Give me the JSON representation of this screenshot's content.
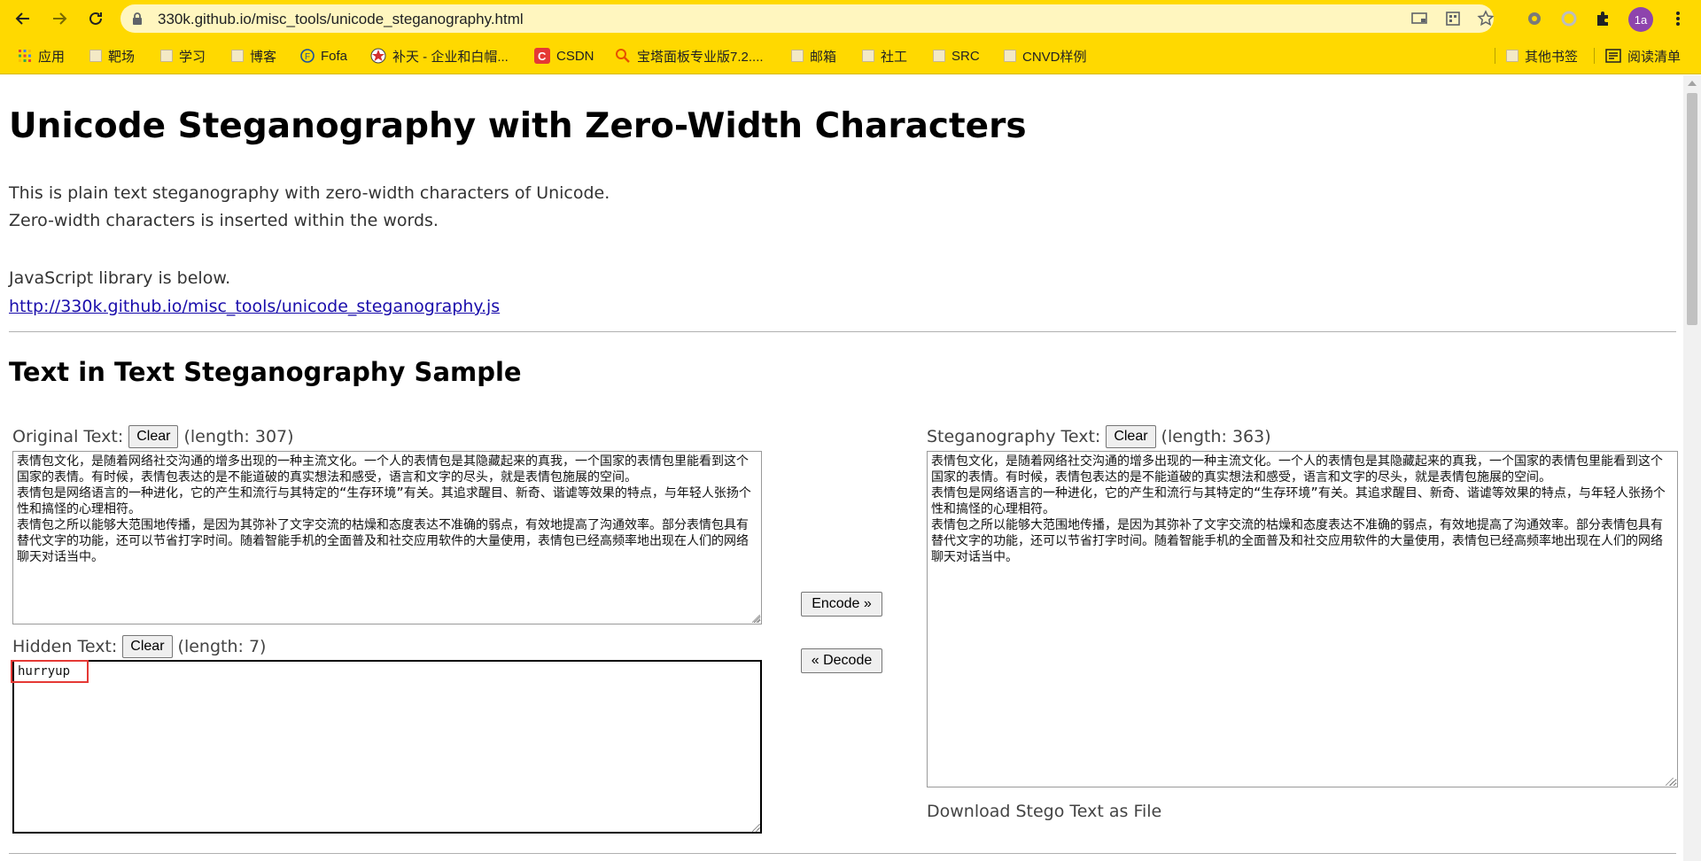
{
  "browser": {
    "url": "330k.github.io/misc_tools/unicode_steganography.html",
    "profile_initials": "1a",
    "bookmarks": [
      {
        "label": "应用",
        "icon": "apps-grid-icon"
      },
      {
        "label": "靶场",
        "icon": "folder-icon"
      },
      {
        "label": "学习",
        "icon": "folder-icon"
      },
      {
        "label": "博客",
        "icon": "folder-icon"
      },
      {
        "label": "Fofa",
        "icon": "fofa-icon"
      },
      {
        "label": "补天 - 企业和白帽...",
        "icon": "butian-icon"
      },
      {
        "label": "CSDN",
        "icon": "csdn-icon"
      },
      {
        "label": "宝塔面板专业版7.2....",
        "icon": "search-icon"
      },
      {
        "label": "邮箱",
        "icon": "folder-icon"
      },
      {
        "label": "社工",
        "icon": "folder-icon"
      },
      {
        "label": "SRC",
        "icon": "folder-icon"
      },
      {
        "label": "CNVD样例",
        "icon": "folder-icon"
      }
    ],
    "other_bookmarks": "其他书签",
    "reading_list": "阅读清单"
  },
  "page": {
    "title": "Unicode Steganography with Zero-Width Characters",
    "intro_line1": "This is plain text steganography with zero-width characters of Unicode.",
    "intro_line2": "Zero-width characters is inserted within the words.",
    "library_text": "JavaScript library is below.",
    "library_link": "http://330k.github.io/misc_tools/unicode_steganography.js",
    "section_title": "Text in Text Steganography Sample",
    "original": {
      "label": "Original Text:",
      "clear": "Clear",
      "length": "(length: 307)",
      "text": "表情包文化，是随着网络社交沟通的增多出现的一种主流文化。一个人的表情包是其隐藏起来的真我，一个国家的表情包里能看到这个国家的表情。有时候，表情包表达的是不能道破的真实想法和感受，语言和文字的尽头，就是表情包施展的空间。\n表情包是网络语言的一种进化，它的产生和流行与其特定的“生存环境”有关。其追求醒目、新奇、谐谑等效果的特点，与年轻人张扬个性和搞怪的心理相符。\n表情包之所以能够大范围地传播，是因为其弥补了文字交流的枯燥和态度表达不准确的弱点，有效地提高了沟通效率。部分表情包具有替代文字的功能，还可以节省打字时间。随着智能手机的全面普及和社交应用软件的大量使用，表情包已经高频率地出现在人们的网络聊天对话当中。"
    },
    "hidden": {
      "label": "Hidden Text:",
      "clear": "Clear",
      "length": "(length: 7)",
      "text": "hurryup"
    },
    "stego": {
      "label": "Steganography Text:",
      "clear": "Clear",
      "length": "(length: 363)",
      "text": "表情包文化，是随着网络社交沟通的增多出现的一种主流文化。一个人的表情包是其隐藏起来的真我，一个国家的表情包里能看到这个国家的表情。有时候，表情包表达的是不能道破的真实想法和感受，语言和文字的尽头，就是表情包施展的空间。\n表情包是网络语言的一种进化，它的产生和流行与其特定的“生存环境”有关。其追求醒目、新奇、谐谑等效果的特点，与年轻人张扬个性和搞怪的心理相符。\n表情包之所以能够大范围地传播，是因为其弥补了文字交流的枯燥和态度表达不准确的弱点，有效地提高了沟通效率。部分表情包具有替代文字的功能，还可以节省打字时间。随着智能手机的全面普及和社交应用软件的大量使用，表情包已经高频率地出现在人们的网络聊天对话当中。"
    },
    "encode_button": "Encode »",
    "decode_button": "« Decode",
    "download_text": "Download Stego Text as File"
  },
  "colors": {
    "chrome": "#ffd900",
    "link": "#1a0dab",
    "highlight": "#e53935"
  }
}
